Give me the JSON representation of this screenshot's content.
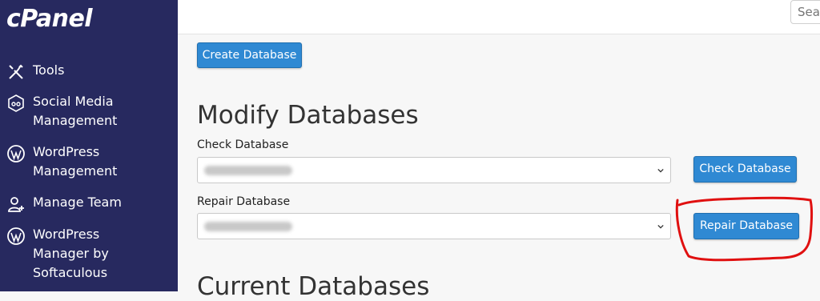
{
  "brand": {
    "logo_text": "cPanel"
  },
  "sidebar": {
    "items": [
      {
        "label": "Tools",
        "icon": "tools-icon"
      },
      {
        "label": "Social Media Management",
        "icon": "social-media-icon"
      },
      {
        "label": "WordPress Management",
        "icon": "wordpress-icon"
      },
      {
        "label": "Manage Team",
        "icon": "team-icon"
      },
      {
        "label": "WordPress Manager by Softaculous",
        "icon": "wordpress-icon"
      }
    ]
  },
  "topbar": {
    "search_placeholder": "Sear"
  },
  "main": {
    "create_button": "Create Database",
    "modify_heading": "Modify Databases",
    "check": {
      "label": "Check Database",
      "button": "Check Database"
    },
    "repair": {
      "label": "Repair Database",
      "button": "Repair Database"
    },
    "current_heading": "Current Databases"
  },
  "colors": {
    "sidebar_bg": "#27295f",
    "button_blue": "#2f89d3",
    "annotation_red": "#e01010"
  }
}
